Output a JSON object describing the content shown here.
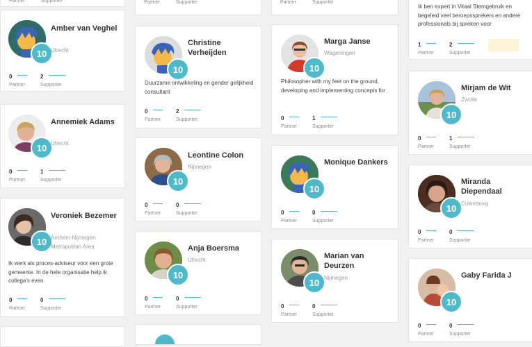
{
  "labels": {
    "partner": "Partner",
    "supporter": "Supporter"
  },
  "badge": "10",
  "cards": {
    "top_col1": {
      "partner": "",
      "supporter": ""
    },
    "top_col2": {
      "partner": "",
      "supporter": ""
    },
    "top_col3": {
      "partner": "",
      "supporter": ""
    },
    "amber": {
      "name": "Amber van Veghel",
      "location": "Utrecht",
      "partner": "0",
      "supporter": "2"
    },
    "annemiek": {
      "name": "Annemiek Adams",
      "location": "Utrecht",
      "partner": "0",
      "supporter": "1"
    },
    "veroniek": {
      "name": "Veroniek Bezemer",
      "location": "Arnhem-Nijmegen Metropolitan Area",
      "description": "Ik werk als proces-adviseur voor een grote gemeente. In de hele organisatie help ik collega's even",
      "partner": "0",
      "supporter": "0"
    },
    "christine": {
      "name": "Christine Verheijden",
      "location": "",
      "description": "Duurzame ontwikkeling en gender gelijkheid consultant",
      "partner": "0",
      "supporter": "2"
    },
    "leontine": {
      "name": "Leontine Colon",
      "location": "Nijmegen",
      "partner": "0",
      "supporter": "0"
    },
    "anja": {
      "name": "Anja Boersma",
      "location": "Utrecht",
      "partner": "0",
      "supporter": "0"
    },
    "marga": {
      "name": "Marga Janse",
      "location": "Wageningen",
      "description": "Philosopher with my feet on the ground, developing and implementing concepts for",
      "partner": "0",
      "supporter": "1"
    },
    "monique": {
      "name": "Monique Dankers",
      "location": "",
      "partner": "0",
      "supporter": "0"
    },
    "marian": {
      "name": "Marian van Deurzen",
      "location": "Nijmegen",
      "partner": "0",
      "supporter": "0"
    },
    "vitaal": {
      "description": "Ik ben expert in Vitaal Stemgebruik en begeleid veel beroepssprekers en andere professionals bij spreken voor",
      "partner": "1",
      "supporter": "2"
    },
    "mirjam": {
      "name": "Mirjam de Wit",
      "location": "Zwolle",
      "partner": "0",
      "supporter": "1"
    },
    "miranda": {
      "name": "Miranda Diependaal",
      "location": "Culemborg",
      "partner": "0",
      "supporter": "0"
    },
    "gaby": {
      "name": "Gaby Farida J",
      "location": "",
      "partner": "0",
      "supporter": "0"
    }
  }
}
